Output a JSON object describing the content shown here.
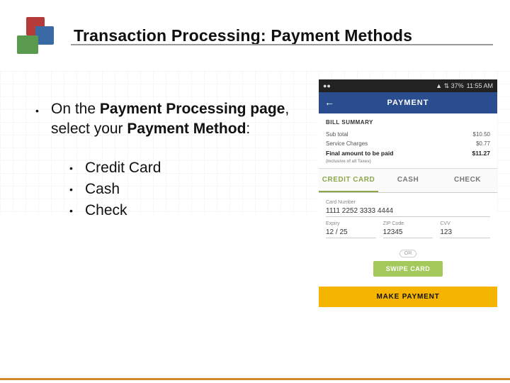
{
  "header": {
    "title": "Transaction Processing: Payment Methods"
  },
  "body": {
    "line1_pre": "On the ",
    "line1_b1": "Payment Processing page",
    "line1_mid": ", select your ",
    "line1_b2": "Payment Method",
    "line1_post": ":",
    "sub": [
      "Credit Card",
      "Cash",
      "Check"
    ]
  },
  "phone": {
    "status": {
      "carrier": "●●",
      "extras": "▲ ⇅ 37%",
      "time": "11:55 AM"
    },
    "appbar": {
      "back": "←",
      "title": "PAYMENT"
    },
    "bill": {
      "heading": "BILL SUMMARY",
      "subtotal_l": "Sub total",
      "subtotal_v": "$10.50",
      "service_l": "Service Charges",
      "service_v": "$0.77",
      "final_l": "Final amount to be paid",
      "final_sub": "(Inclusive of all Taxes)",
      "final_v": "$11.27"
    },
    "tabs": {
      "t1": "CREDIT CARD",
      "t2": "CASH",
      "t3": "CHECK"
    },
    "card": {
      "num_l": "Card Number",
      "num_v": "1111 2252 3333 4444",
      "exp_l": "Expiry",
      "exp_v": "12 / 25",
      "zip_l": "ZIP Code",
      "zip_v": "12345",
      "cvv_l": "CVV",
      "cvv_v": "123",
      "or": "OR",
      "swipe": "SWIPE CARD"
    },
    "makepay": "MAKE PAYMENT"
  }
}
